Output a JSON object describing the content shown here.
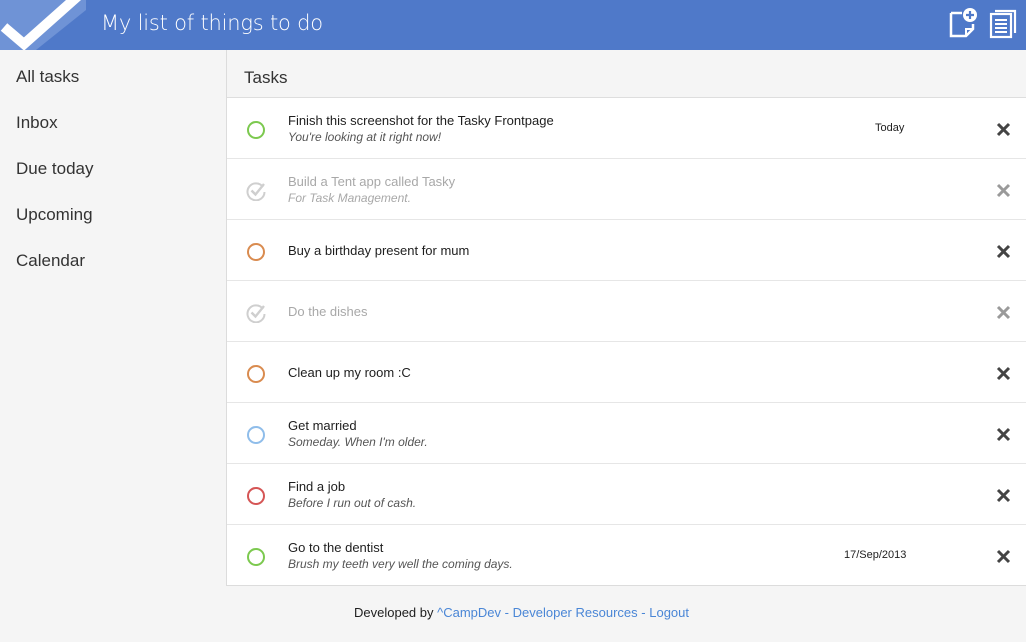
{
  "header": {
    "title": "My list of things to do",
    "logo_icon": "checkmark-logo-icon",
    "new_task_icon": "new-note-icon",
    "list_icon": "notes-list-icon",
    "color": "#4f79c9"
  },
  "sidebar": {
    "items": [
      {
        "label": "All tasks"
      },
      {
        "label": "Inbox"
      },
      {
        "label": "Due today"
      },
      {
        "label": "Upcoming"
      },
      {
        "label": "Calendar"
      }
    ]
  },
  "main": {
    "title": "Tasks",
    "tasks": [
      {
        "name": "Finish this screenshot for the Tasky Frontpage",
        "note": "You're looking at it right now!",
        "due": "Today",
        "status": "open",
        "color": "#7cc94f"
      },
      {
        "name": "Build a Tent app called Tasky",
        "note": "For Task Management.",
        "due": "",
        "status": "done",
        "color": "#cfcfcf"
      },
      {
        "name": "Buy a birthday present for mum",
        "note": "",
        "due": "",
        "status": "open",
        "color": "#d98b4f"
      },
      {
        "name": "Do the dishes",
        "note": "",
        "due": "",
        "status": "done",
        "color": "#cfcfcf"
      },
      {
        "name": "Clean up my room :C",
        "note": "",
        "due": "",
        "status": "open",
        "color": "#d98b4f"
      },
      {
        "name": "Get married",
        "note": "Someday. When I'm older.",
        "due": "",
        "status": "open",
        "color": "#8fbdea"
      },
      {
        "name": "Find a job",
        "note": "Before I run out of cash.",
        "due": "",
        "status": "open",
        "color": "#d55555"
      },
      {
        "name": "Go to the dentist",
        "note": "Brush my teeth very well the coming days.",
        "due": "17/Sep/2013",
        "status": "open",
        "color": "#7cc94f"
      }
    ],
    "delete_icon": "close-icon",
    "done_icon": "checkmark-icon"
  },
  "footer": {
    "prefix": "Developed by",
    "link1": "^CampDev",
    "link2": "Developer Resources",
    "link3": "Logout",
    "separator": "-"
  }
}
